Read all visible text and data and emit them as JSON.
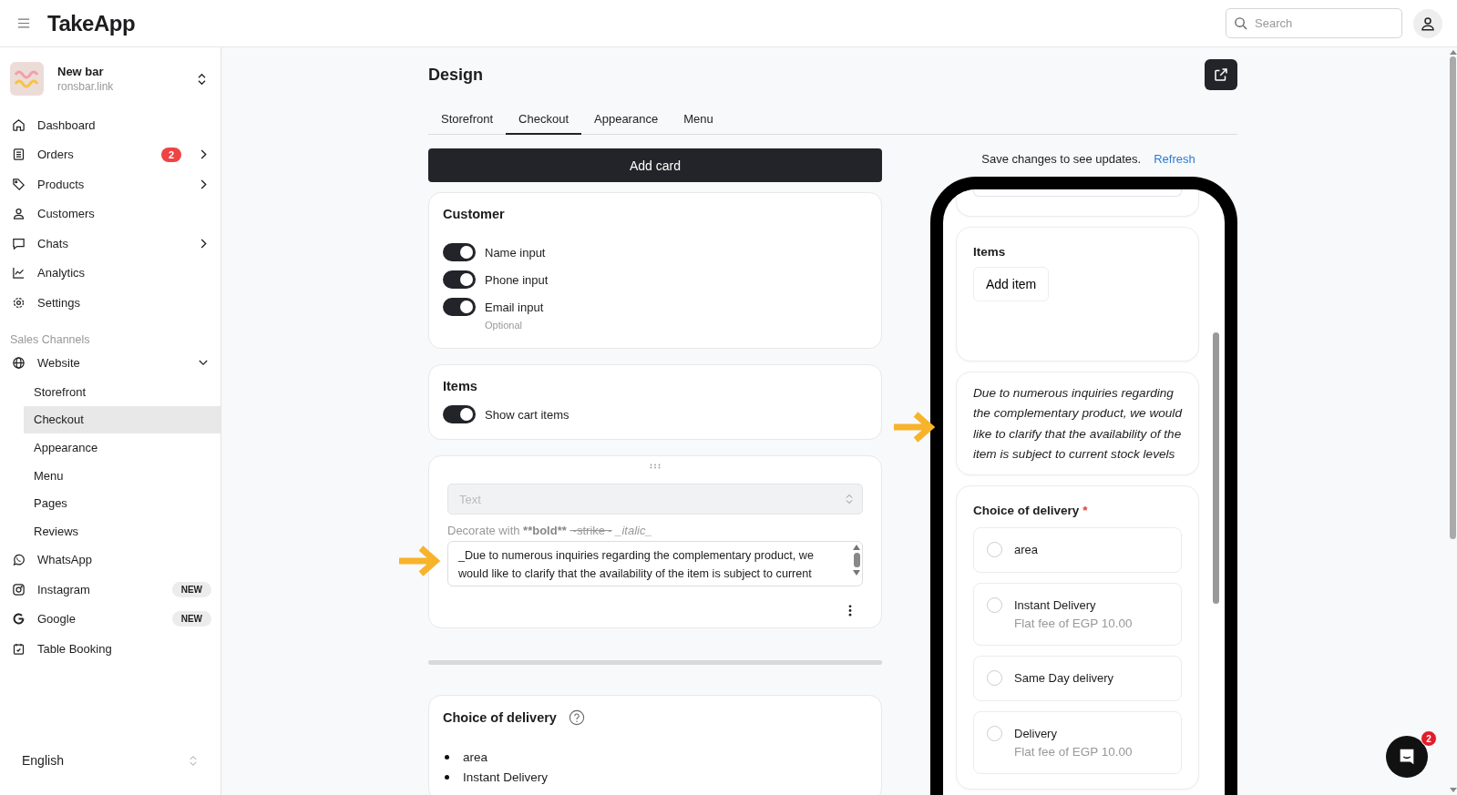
{
  "app": {
    "title": "TakeApp"
  },
  "search": {
    "placeholder": "Search"
  },
  "store": {
    "name": "New bar",
    "domain": "ronsbar.link"
  },
  "nav": [
    {
      "label": "Dashboard",
      "kind": "home"
    },
    {
      "label": "Orders",
      "kind": "list",
      "badge": "2",
      "arrow": true
    },
    {
      "label": "Products",
      "kind": "tag",
      "arrow": true
    },
    {
      "label": "Customers",
      "kind": "user"
    },
    {
      "label": "Chats",
      "kind": "chat",
      "arrow": true
    },
    {
      "label": "Analytics",
      "kind": "chart"
    },
    {
      "label": "Settings",
      "kind": "gear"
    }
  ],
  "sales_channels": {
    "heading": "Sales Channels",
    "items": [
      {
        "label": "Website",
        "kind": "globe",
        "expanded": true,
        "children": [
          {
            "label": "Storefront",
            "selected": false
          },
          {
            "label": "Checkout",
            "selected": true
          },
          {
            "label": "Appearance",
            "selected": false
          },
          {
            "label": "Menu",
            "selected": false
          },
          {
            "label": "Pages",
            "selected": false
          },
          {
            "label": "Reviews",
            "selected": false
          }
        ]
      },
      {
        "label": "WhatsApp",
        "kind": "whatsapp"
      },
      {
        "label": "Instagram",
        "kind": "instagram",
        "badge": "NEW"
      },
      {
        "label": "Google",
        "kind": "google",
        "badge": "NEW"
      },
      {
        "label": "Table Booking",
        "kind": "calendar"
      }
    ]
  },
  "language": "English",
  "page": {
    "title": "Design",
    "tabs": [
      {
        "label": "Storefront",
        "selected": false
      },
      {
        "label": "Checkout",
        "selected": true
      },
      {
        "label": "Appearance",
        "selected": false
      },
      {
        "label": "Menu",
        "selected": false
      }
    ]
  },
  "add_card": "Add card",
  "customer_card": {
    "title": "Customer",
    "toggles": [
      {
        "label": "Name input",
        "on": true
      },
      {
        "label": "Phone input",
        "on": true
      },
      {
        "label": "Email input",
        "on": true,
        "note": "Optional"
      }
    ]
  },
  "items_card": {
    "title": "Items",
    "toggles": [
      {
        "label": "Show cart items",
        "on": true
      }
    ]
  },
  "text_card": {
    "select": {
      "placeholder": "Text"
    },
    "hint": [
      {
        "kind": "plain",
        "text": "Decorate with "
      },
      {
        "kind": "bold",
        "text": "**bold** "
      },
      {
        "kind": "strike",
        "text": "~strike~"
      },
      {
        "kind": "italic",
        "text": " _italic_"
      }
    ],
    "value": "_Due to numerous inquiries regarding the complementary product, we would like to clarify that the availability of the item is subject to current"
  },
  "delivery_card": {
    "title": "Choice of delivery",
    "options": [
      "area",
      "Instant Delivery"
    ]
  },
  "preview": {
    "notice": "Save changes to see updates.",
    "refresh": "Refresh",
    "items_title": "Items",
    "add_item": "Add item",
    "message": "Due to numerous inquiries regarding the complementary product, we would like to clarify that the availability of the item is subject to current stock levels",
    "delivery": {
      "title": "Choice of delivery",
      "required_mark": "*",
      "options": [
        {
          "label": "area",
          "selected": false
        },
        {
          "label": "Instant Delivery",
          "fee": "Flat fee of EGP 10.00",
          "selected": false
        },
        {
          "label": "Same Day delivery",
          "selected": false
        },
        {
          "label": "Delivery",
          "fee": "Flat fee of EGP 10.00",
          "selected": false
        }
      ]
    }
  },
  "chat": {
    "badge": "2"
  }
}
